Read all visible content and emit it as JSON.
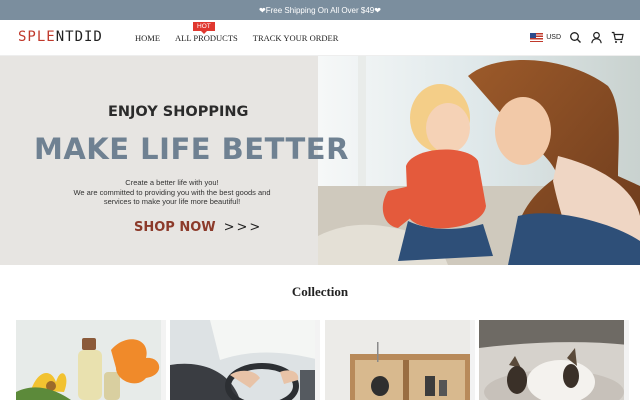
{
  "announcement": "❤Free Shipping On All Over $49❤",
  "header": {
    "logo_part1": "SPLE",
    "logo_part2": "NTDID",
    "nav": {
      "home": "HOME",
      "all_products": "ALL PRODUCTS",
      "hot_badge": "HOT",
      "track_order": "TRACK YOUR ORDER"
    },
    "currency": "USD",
    "icons": [
      "us-flag-icon",
      "search-icon",
      "account-icon",
      "cart-icon"
    ]
  },
  "hero": {
    "title_small": "ENJOY SHOPPING",
    "title_large": "MAKE LIFE BETTER",
    "subtitle_lines": [
      "Create a better life with you!",
      "We are committed to providing you with the best goods and",
      "services to make your life more beautiful!"
    ],
    "cta_label": "SHOP NOW",
    "cta_arrows": ">>>"
  },
  "collection": {
    "title": "Collection"
  },
  "colors": {
    "announcement_bg": "#7b8e9e",
    "logo_accent": "#c0392b",
    "hot_badge": "#e0382f",
    "hero_title_large": "#6f8192",
    "cta": "#8c3a2a"
  }
}
